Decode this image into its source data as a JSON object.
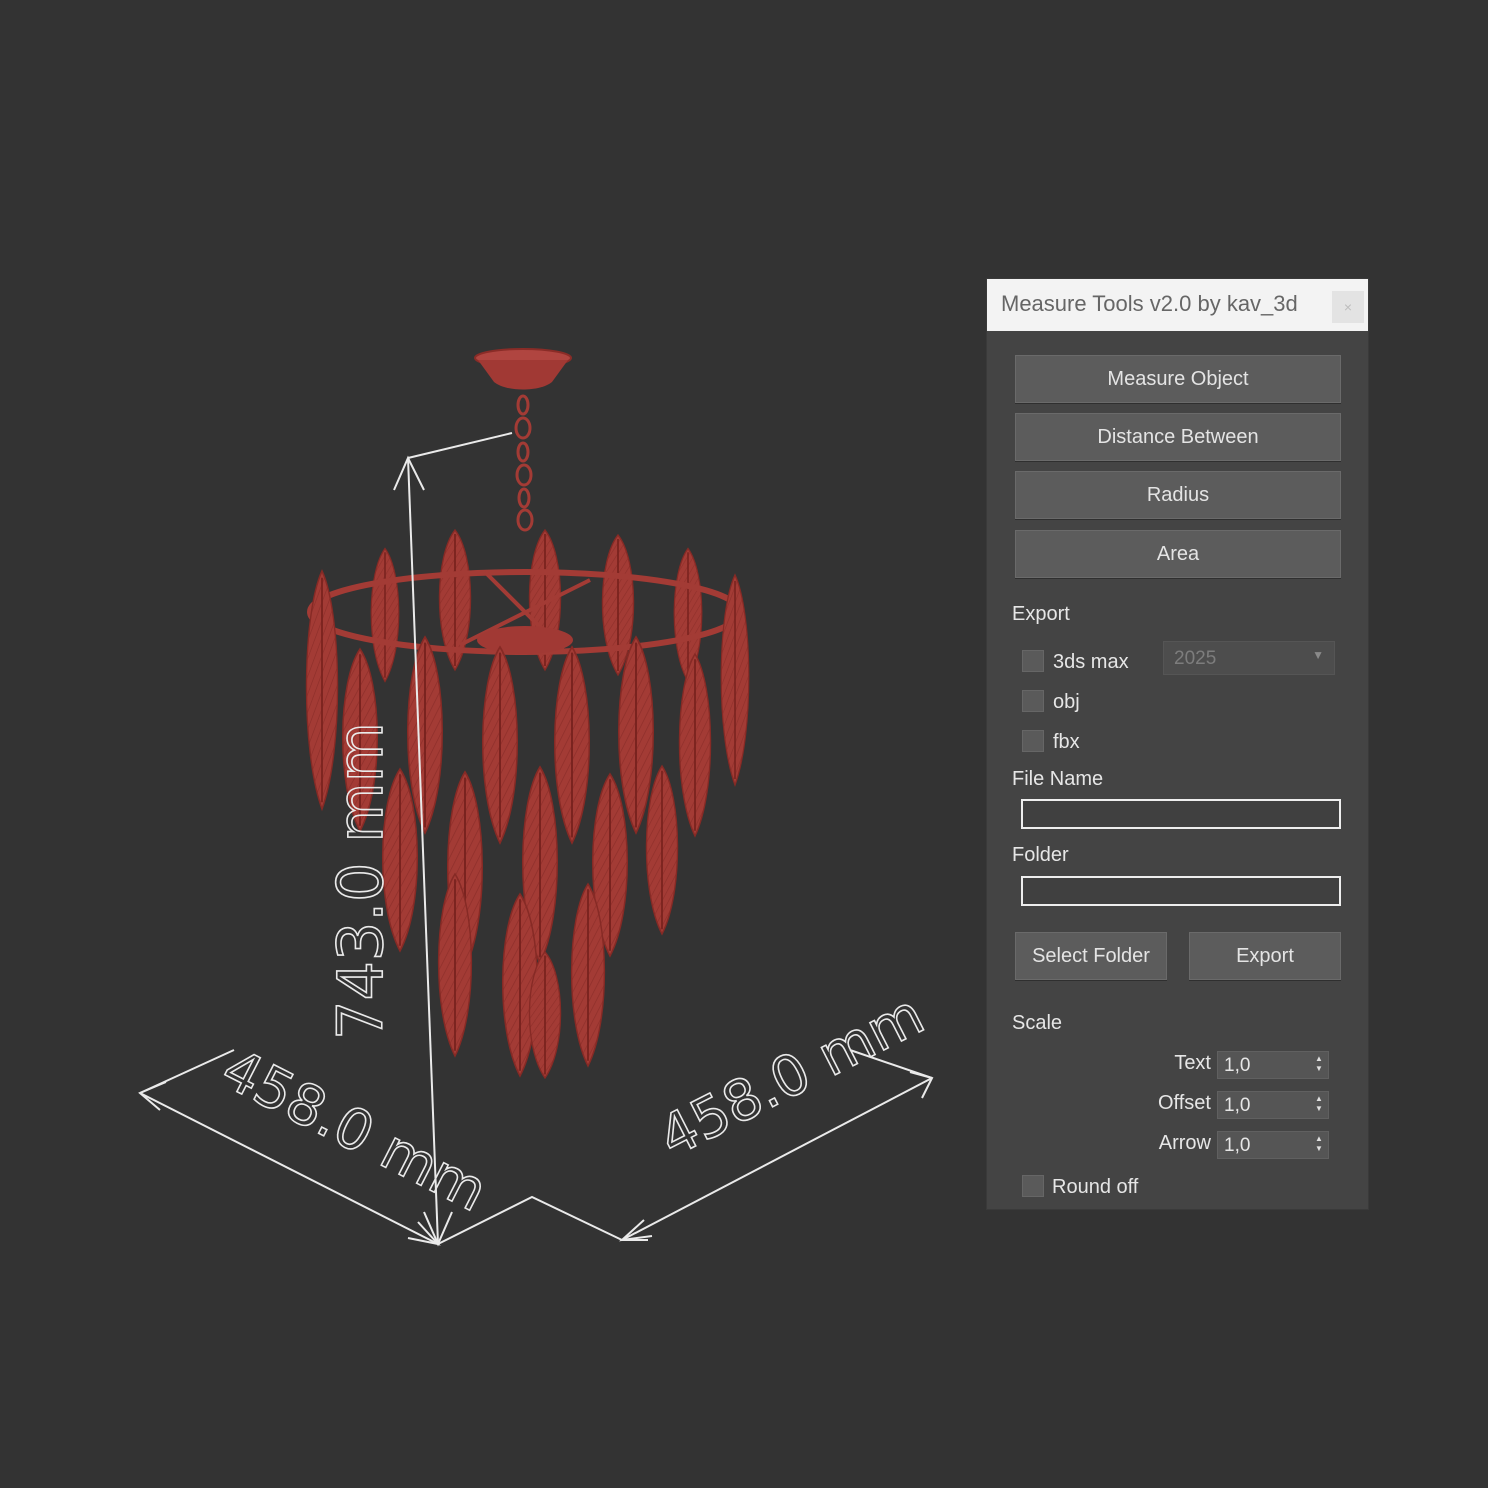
{
  "viewport": {
    "dimensions": {
      "height": "743.0 mm",
      "width": "458.0 mm",
      "depth": "458.0 mm"
    },
    "colors": {
      "model": "#a23a34",
      "dimension_lines": "#eaeaea",
      "background": "#333333"
    }
  },
  "dialog": {
    "title": "Measure Tools v2.0  by kav_3d",
    "close_label": "×",
    "buttons": {
      "measure_object": "Measure Object",
      "distance_between": "Distance Between",
      "radius": "Radius",
      "area": "Area",
      "select_folder": "Select Folder",
      "export": "Export"
    },
    "export_section": {
      "label": "Export",
      "options": [
        {
          "label": "3ds max",
          "checked": false
        },
        {
          "label": "obj",
          "checked": false
        },
        {
          "label": "fbx",
          "checked": false
        }
      ],
      "version_select": {
        "value": "2025"
      }
    },
    "file_name": {
      "label": "File Name",
      "value": ""
    },
    "folder": {
      "label": "Folder",
      "value": ""
    },
    "scale": {
      "label": "Scale",
      "fields": [
        {
          "label": "Text",
          "value": "1,0"
        },
        {
          "label": "Offset",
          "value": "1,0"
        },
        {
          "label": "Arrow",
          "value": "1,0"
        }
      ]
    },
    "round_off": {
      "label": "Round off",
      "checked": false
    }
  }
}
